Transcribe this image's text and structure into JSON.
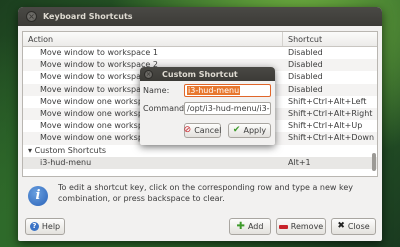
{
  "window": {
    "title": "Keyboard Shortcuts",
    "close_glyph": "×"
  },
  "list": {
    "headers": {
      "action": "Action",
      "shortcut": "Shortcut"
    },
    "rows": [
      {
        "action": "Move window to workspace 1",
        "shortcut": "Disabled"
      },
      {
        "action": "Move window to workspace 2",
        "shortcut": "Disabled"
      },
      {
        "action": "Move window to workspace 3",
        "shortcut": "Disabled"
      },
      {
        "action": "Move window to workspace 4",
        "shortcut": "Disabled"
      },
      {
        "action": "Move window one workspace to the left",
        "shortcut": "Shift+Ctrl+Alt+Left"
      },
      {
        "action": "Move window one workspace to the right",
        "shortcut": "Shift+Ctrl+Alt+Right"
      },
      {
        "action": "Move window one workspace up",
        "shortcut": "Shift+Ctrl+Alt+Up"
      },
      {
        "action": "Move window one workspace down",
        "shortcut": "Shift+Ctrl+Alt+Down"
      }
    ],
    "group": {
      "label": "Custom Shortcuts",
      "expander": "▾"
    },
    "custom_rows": [
      {
        "action": "i3-hud-menu",
        "shortcut": "Alt+1"
      }
    ]
  },
  "info": {
    "icon_glyph": "i",
    "text": "To edit a shortcut key, click on the corresponding row and type a new key combination, or press backspace to clear."
  },
  "buttons": {
    "help": "Help",
    "help_glyph": "?",
    "add": "Add",
    "add_glyph": "✚",
    "remove": "Remove",
    "close": "Close",
    "close_glyph": "✖"
  },
  "dialog": {
    "title": "Custom Shortcut",
    "close_glyph": "×",
    "name_label": "Name:",
    "name_value": "i3-hud-menu",
    "command_label": "Command:",
    "command_value": "/opt/i3-hud-menu/i3-h",
    "cancel": "Cancel",
    "cancel_glyph": "⊘",
    "apply": "Apply",
    "apply_glyph": "✔"
  },
  "colors": {
    "accent_orange": "#e8772e",
    "titlebar": "#3c3b37",
    "window_bg": "#f2f1f0"
  }
}
